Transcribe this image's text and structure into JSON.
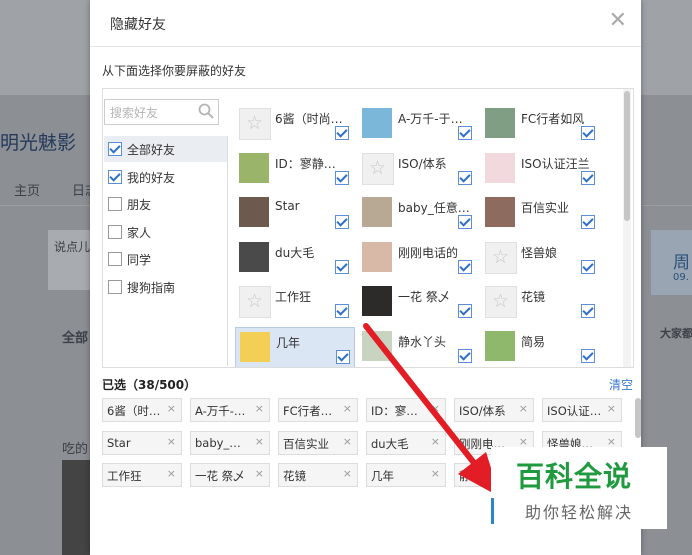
{
  "background": {
    "site_name": "明光魅影",
    "nav_home": "主页",
    "nav_diary": "日志",
    "say_placeholder": "说点儿",
    "all_label": "全部",
    "eat_label": "吃的",
    "week_label": "周",
    "date_label": "09.",
    "everyone_label": "大家都"
  },
  "dialog": {
    "title": "隐藏好友",
    "subtitle": "从下面选择你要屏蔽的好友",
    "search_placeholder": "搜索好友",
    "groups": [
      {
        "label": "全部好友",
        "checked": true
      },
      {
        "label": "我的好友",
        "checked": true
      },
      {
        "label": "朋友",
        "checked": false
      },
      {
        "label": "家人",
        "checked": false
      },
      {
        "label": "同学",
        "checked": false
      },
      {
        "label": "搜狗指南",
        "checked": false
      }
    ],
    "friends": [
      {
        "name": "6酱（时尚…",
        "avatar": "star-placeholder",
        "color": ""
      },
      {
        "name": "A-万千-于…",
        "avatar": "photo",
        "color": "#7ab7d9"
      },
      {
        "name": "FC行者如风",
        "avatar": "photo",
        "color": "#7f9e83"
      },
      {
        "name": "ID：寥静…",
        "avatar": "photo",
        "color": "#9ab56a"
      },
      {
        "name": "ISO/体系",
        "avatar": "star-placeholder",
        "color": ""
      },
      {
        "name": "ISO认证汪兰",
        "avatar": "photo",
        "color": "#f1d9de"
      },
      {
        "name": "Star",
        "avatar": "photo",
        "color": "#6d5a4e"
      },
      {
        "name": "baby_任意…",
        "avatar": "photo",
        "color": "#b8a995"
      },
      {
        "name": "百信实业",
        "avatar": "photo",
        "color": "#8d6b5e"
      },
      {
        "name": "du大毛",
        "avatar": "photo",
        "color": "#4a4a4a"
      },
      {
        "name": "刚刚电话的",
        "avatar": "photo",
        "color": "#d8b9a8"
      },
      {
        "name": "怪兽娘",
        "avatar": "star-placeholder",
        "color": ""
      },
      {
        "name": "工作狂",
        "avatar": "star-placeholder",
        "color": ""
      },
      {
        "name": "一花 祭乄",
        "avatar": "photo",
        "color": "#2d2a2a"
      },
      {
        "name": "花镜",
        "avatar": "star-placeholder",
        "color": ""
      },
      {
        "name": "几年",
        "avatar": "photo",
        "color": "#f3cf56"
      },
      {
        "name": "静水丫头",
        "avatar": "photo",
        "color": "#c8d4c0"
      },
      {
        "name": "简易",
        "avatar": "photo",
        "color": "#8fb86d"
      }
    ],
    "selected_label": "已选（38/500）",
    "clear_label": "清空",
    "chips": [
      "6酱（时…",
      "A-万千-…",
      "FC行者…",
      "ID：寥…",
      "ISO/体系",
      "ISO认证…",
      "Star",
      "baby_…",
      "百信实业",
      "du大毛",
      "刚刚电…",
      "怪兽娘…",
      "工作狂",
      "一花 祭乄",
      "花镜",
      "几年",
      "静水丫…"
    ],
    "close_icon": "close-icon",
    "remove_icon": "×"
  },
  "watermark": {
    "title": "百科全说",
    "subtitle": "助你轻松解决"
  },
  "colors": {
    "accent": "#2f6fcc",
    "arrow": "#e21d25",
    "watermark_green": "#1f9a3e"
  }
}
